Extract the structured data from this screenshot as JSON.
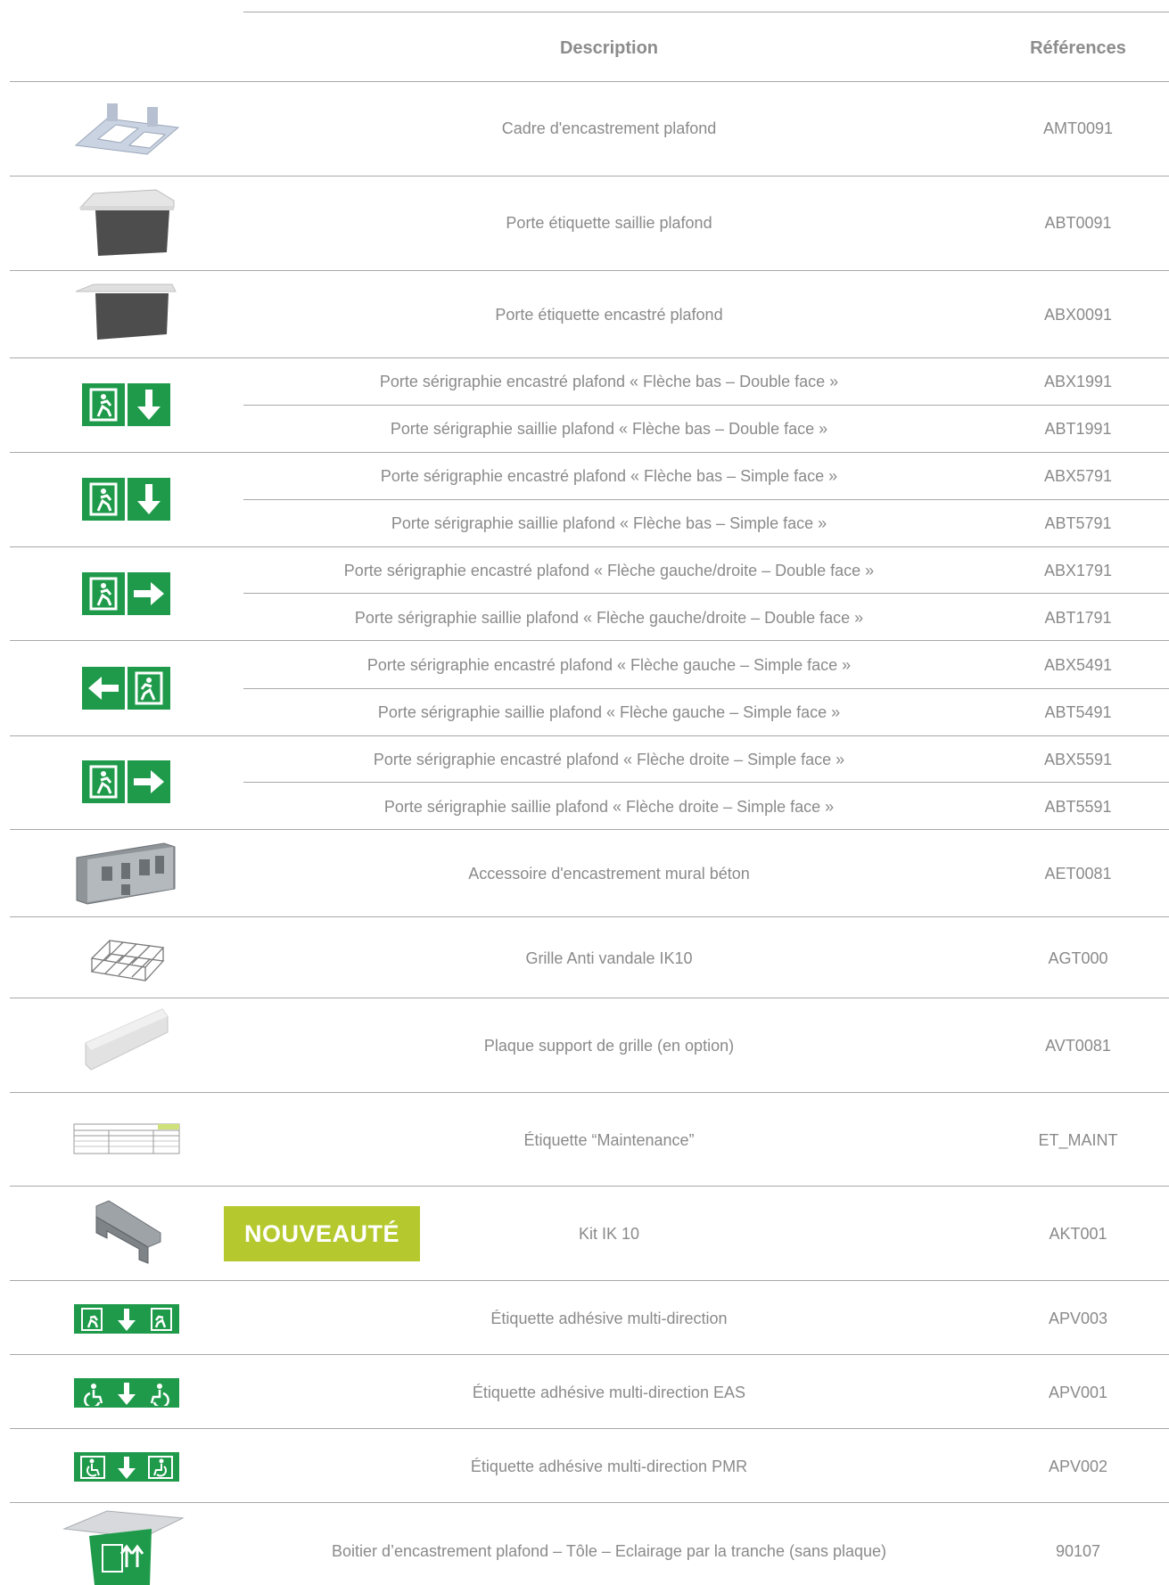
{
  "header": {
    "description": "Description",
    "references": "Références"
  },
  "rows": [
    {
      "desc": "Cadre d'encastrement plafond",
      "ref": "AMT0091"
    },
    {
      "desc": "Porte étiquette saillie plafond",
      "ref": "ABT0091"
    },
    {
      "desc": "Porte étiquette encastré plafond",
      "ref": "ABX0091"
    },
    {
      "desc": "Porte sérigraphie encastré plafond « Flèche bas – Double face »",
      "ref": "ABX1991"
    },
    {
      "desc": "Porte sérigraphie saillie plafond « Flèche bas – Double face »",
      "ref": "ABT1991"
    },
    {
      "desc": "Porte sérigraphie encastré plafond « Flèche bas – Simple face »",
      "ref": "ABX5791"
    },
    {
      "desc": "Porte sérigraphie saillie plafond « Flèche bas – Simple face »",
      "ref": "ABT5791"
    },
    {
      "desc": "Porte sérigraphie encastré plafond « Flèche gauche/droite – Double face »",
      "ref": "ABX1791"
    },
    {
      "desc": "Porte sérigraphie saillie plafond « Flèche gauche/droite – Double face »",
      "ref": "ABT1791"
    },
    {
      "desc": "Porte sérigraphie encastré plafond « Flèche gauche – Simple face »",
      "ref": "ABX5491"
    },
    {
      "desc": "Porte sérigraphie saillie plafond « Flèche gauche – Simple face »",
      "ref": "ABT5491"
    },
    {
      "desc": "Porte sérigraphie encastré plafond « Flèche droite – Simple face »",
      "ref": "ABX5591"
    },
    {
      "desc": "Porte sérigraphie saillie plafond « Flèche droite – Simple face »",
      "ref": "ABT5591"
    },
    {
      "desc": "Accessoire d'encastrement mural béton",
      "ref": "AET0081"
    },
    {
      "desc": "Grille Anti vandale IK10",
      "ref": "AGT000"
    },
    {
      "desc": "Plaque support de grille (en option)",
      "ref": "AVT0081"
    },
    {
      "desc": "Étiquette “Maintenance”",
      "ref": "ET_MAINT"
    },
    {
      "desc": "Kit IK 10",
      "ref": "AKT001"
    },
    {
      "desc": "Étiquette adhésive multi-direction",
      "ref": "APV003"
    },
    {
      "desc": "Étiquette adhésive multi-direction EAS",
      "ref": "APV001"
    },
    {
      "desc": "Étiquette adhésive multi-direction PMR",
      "ref": "APV002"
    },
    {
      "desc": "Boitier d’encastrement plafond – Tôle – Eclairage par la tranche (sans plaque)",
      "ref": "90107"
    }
  ],
  "badge": "NOUVEAUTÉ",
  "colors": {
    "sign_green": "#1e9a4a",
    "badge_green": "#b5c92e",
    "rule_gray": "#a8a8a8"
  }
}
